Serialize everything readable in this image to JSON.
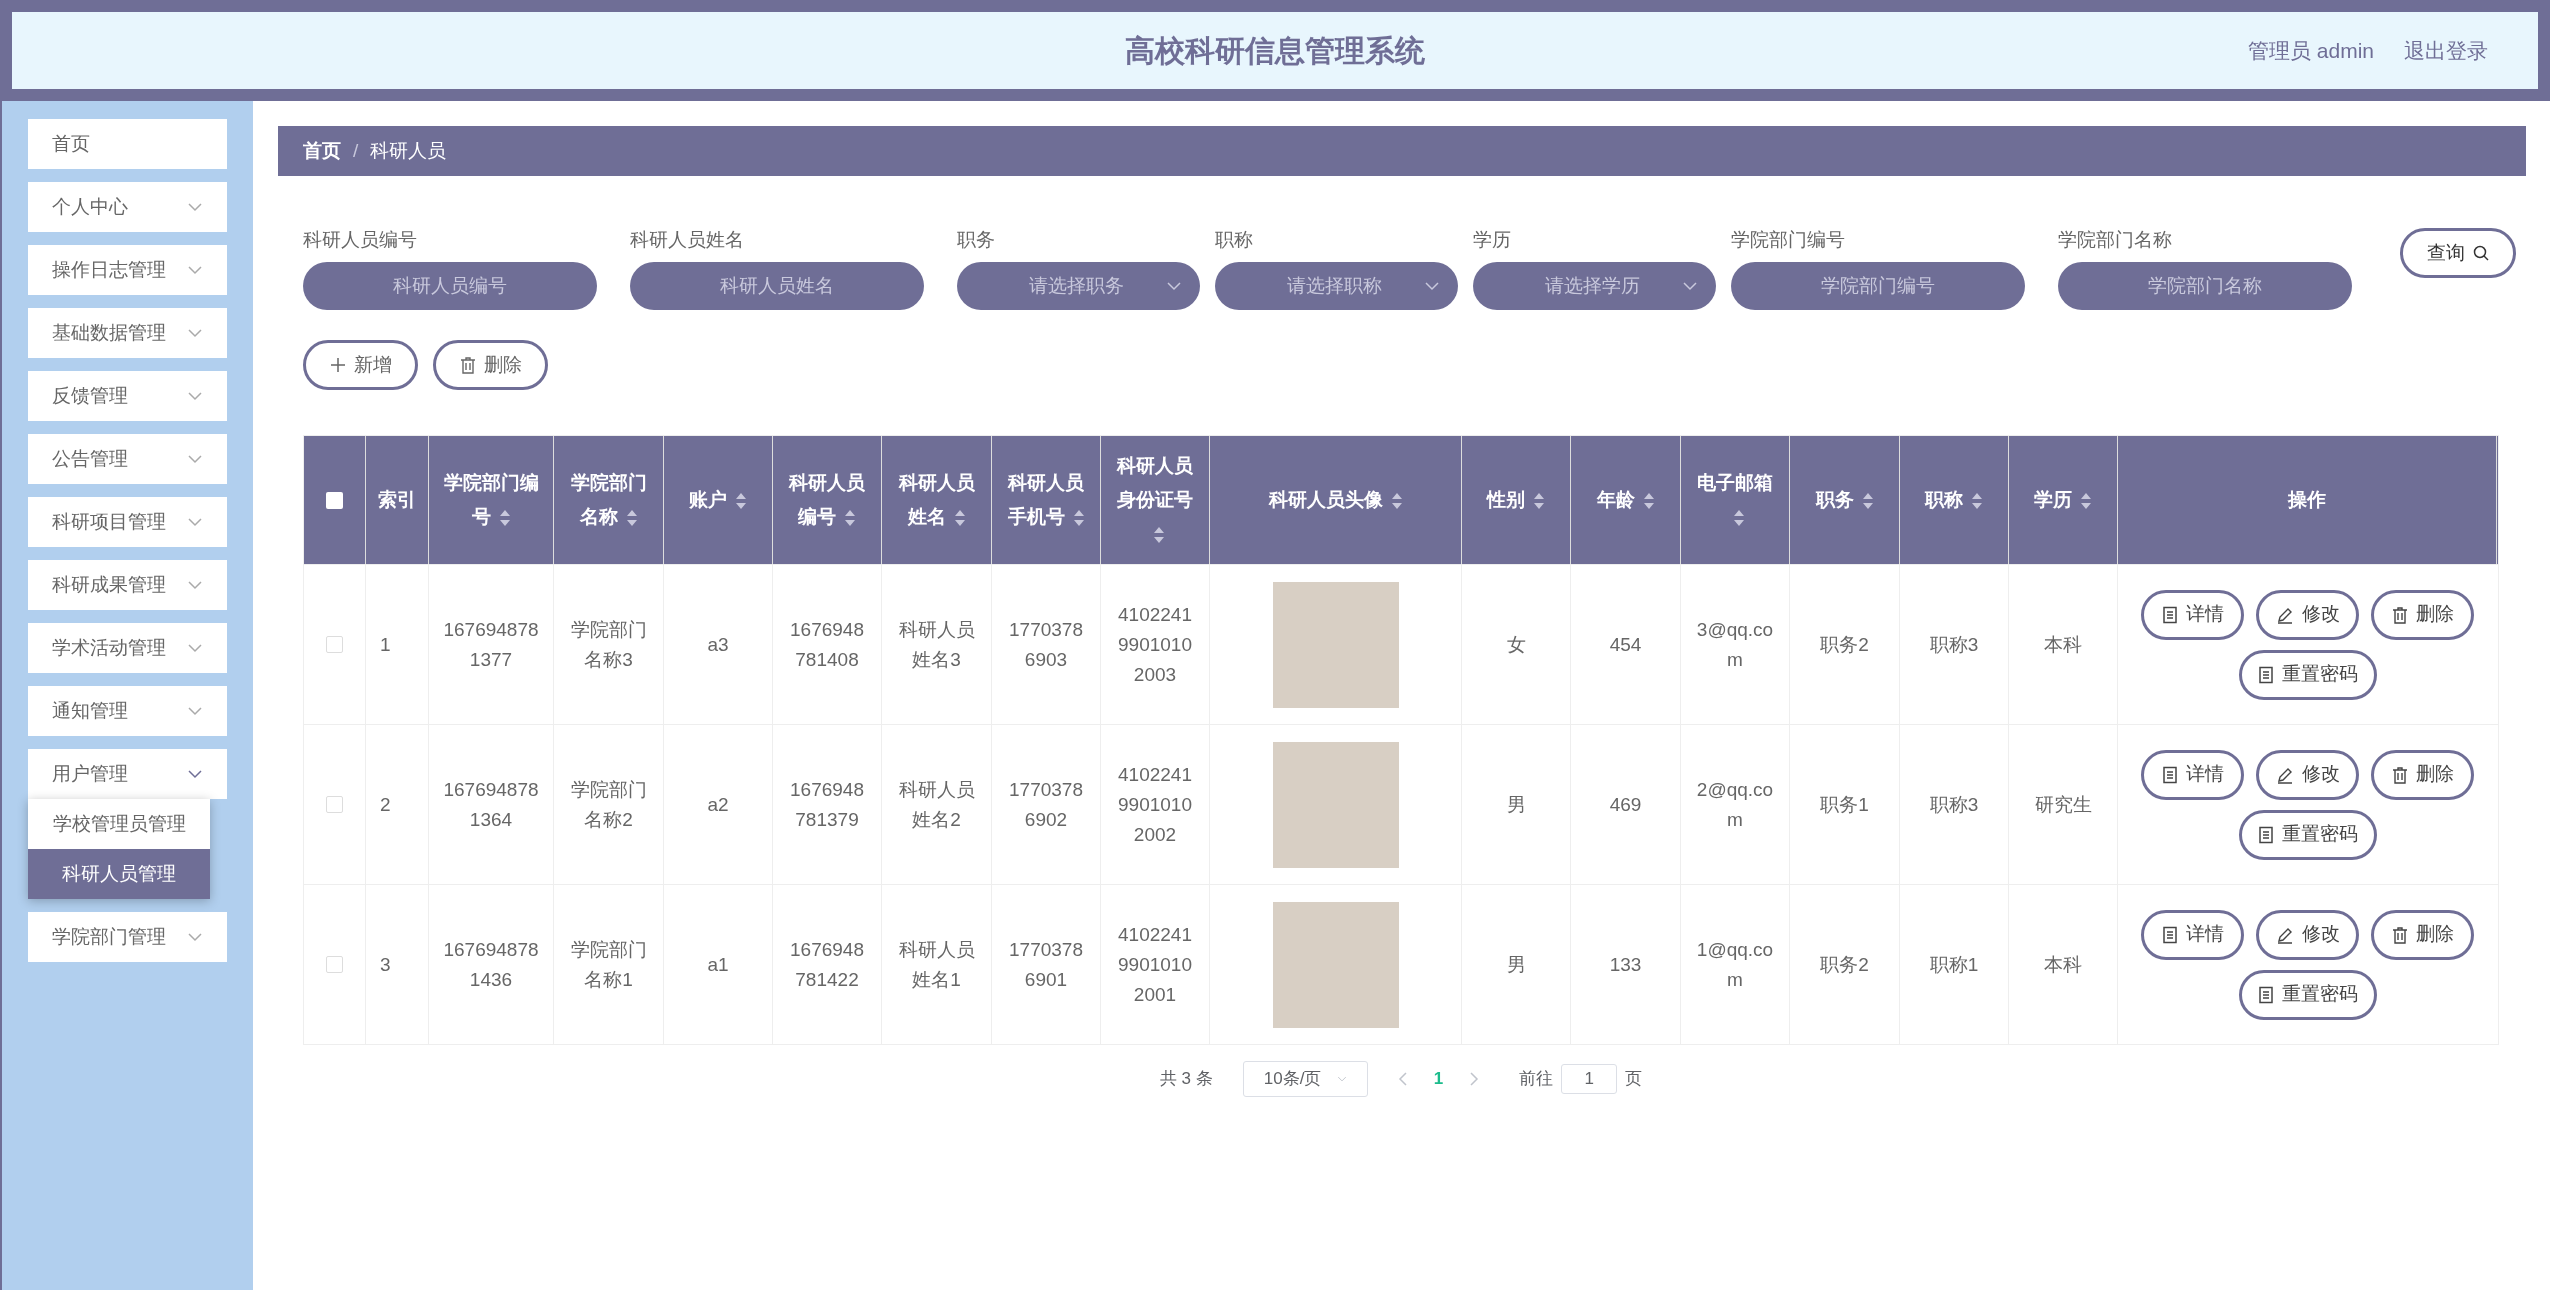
{
  "header": {
    "title": "高校科研信息管理系统",
    "user": "管理员 admin",
    "logout": "退出登录"
  },
  "sidebar": {
    "items": [
      {
        "label": "首页",
        "expandable": false
      },
      {
        "label": "个人中心",
        "expandable": true,
        "expanded": false
      },
      {
        "label": "操作日志管理",
        "expandable": true,
        "expanded": false
      },
      {
        "label": "基础数据管理",
        "expandable": true,
        "expanded": false
      },
      {
        "label": "反馈管理",
        "expandable": true,
        "expanded": false
      },
      {
        "label": "公告管理",
        "expandable": true,
        "expanded": false
      },
      {
        "label": "科研项目管理",
        "expandable": true,
        "expanded": false
      },
      {
        "label": "科研成果管理",
        "expandable": true,
        "expanded": false
      },
      {
        "label": "学术活动管理",
        "expandable": true,
        "expanded": false
      },
      {
        "label": "通知管理",
        "expandable": true,
        "expanded": false
      },
      {
        "label": "用户管理",
        "expandable": true,
        "expanded": true,
        "children": [
          {
            "label": "学校管理员管理",
            "selected": false
          },
          {
            "label": "科研人员管理",
            "selected": true
          }
        ]
      },
      {
        "label": "学院部门管理",
        "expandable": true,
        "expanded": false
      }
    ]
  },
  "breadcrumb": {
    "separator": "/",
    "items": [
      "首页",
      "科研人员"
    ]
  },
  "filters": [
    {
      "label": "科研人员编号",
      "kind": "input",
      "placeholder": "科研人员编号"
    },
    {
      "label": "科研人员姓名",
      "kind": "input",
      "placeholder": "科研人员姓名"
    },
    {
      "label": "职务",
      "kind": "select",
      "placeholder": "请选择职务"
    },
    {
      "label": "职称",
      "kind": "select",
      "placeholder": "请选择职称"
    },
    {
      "label": "学历",
      "kind": "select",
      "placeholder": "请选择学历"
    },
    {
      "label": "学院部门编号",
      "kind": "input",
      "placeholder": "学院部门编号"
    },
    {
      "label": "学院部门名称",
      "kind": "input",
      "placeholder": "学院部门名称"
    }
  ],
  "search_button": "查询",
  "toolbar": [
    {
      "kind": "add",
      "label": "新增"
    },
    {
      "kind": "delete",
      "label": "删除"
    }
  ],
  "table": {
    "select_all_checked": false,
    "columns": [
      {
        "label": "索引",
        "sortable": false
      },
      {
        "label": "学院部门编号",
        "sortable": true
      },
      {
        "label": "学院部门名称",
        "sortable": true
      },
      {
        "label": "账户",
        "sortable": true
      },
      {
        "label": "科研人员编号",
        "sortable": true
      },
      {
        "label": "科研人员姓名",
        "sortable": true
      },
      {
        "label": "科研人员手机号",
        "sortable": true
      },
      {
        "label": "科研人员身份证号",
        "sortable": true
      },
      {
        "label": "科研人员头像",
        "sortable": true
      },
      {
        "label": "性别",
        "sortable": true
      },
      {
        "label": "年龄",
        "sortable": true
      },
      {
        "label": "电子邮箱",
        "sortable": true
      },
      {
        "label": "职务",
        "sortable": true
      },
      {
        "label": "职称",
        "sortable": true
      },
      {
        "label": "学历",
        "sortable": true
      },
      {
        "label": "操作",
        "sortable": false
      }
    ],
    "rows": [
      {
        "checked": false,
        "cells": [
          "1",
          "1676948781377",
          "学院部门名称3",
          "a3",
          "1676948781408",
          "科研人员姓名3",
          "17703786903",
          "410224199010102003",
          null,
          "女",
          "454",
          "3@qq.com",
          "职务2",
          "职称3",
          "本科"
        ],
        "actions": [
          {
            "kind": "detail",
            "label": "详情"
          },
          {
            "kind": "edit",
            "label": "修改"
          },
          {
            "kind": "delete",
            "label": "删除"
          },
          {
            "kind": "reset",
            "label": "重置密码"
          }
        ]
      },
      {
        "checked": false,
        "cells": [
          "2",
          "1676948781364",
          "学院部门名称2",
          "a2",
          "1676948781379",
          "科研人员姓名2",
          "17703786902",
          "410224199010102002",
          null,
          "男",
          "469",
          "2@qq.com",
          "职务1",
          "职称3",
          "研究生"
        ],
        "actions": [
          {
            "kind": "detail",
            "label": "详情"
          },
          {
            "kind": "edit",
            "label": "修改"
          },
          {
            "kind": "delete",
            "label": "删除"
          },
          {
            "kind": "reset",
            "label": "重置密码"
          }
        ]
      },
      {
        "checked": false,
        "cells": [
          "3",
          "1676948781436",
          "学院部门名称1",
          "a1",
          "1676948781422",
          "科研人员姓名1",
          "17703786901",
          "410224199010102001",
          null,
          "男",
          "133",
          "1@qq.com",
          "职务2",
          "职称1",
          "本科"
        ],
        "actions": [
          {
            "kind": "detail",
            "label": "详情"
          },
          {
            "kind": "edit",
            "label": "修改"
          },
          {
            "kind": "delete",
            "label": "删除"
          },
          {
            "kind": "reset",
            "label": "重置密码"
          }
        ]
      }
    ]
  },
  "pagination": {
    "total": "共 3 条",
    "page_size": "10条/页",
    "pages": [
      {
        "label": "1",
        "selected": true
      }
    ],
    "goto": "前往",
    "goto_value": "1",
    "page_suffix": "页"
  }
}
